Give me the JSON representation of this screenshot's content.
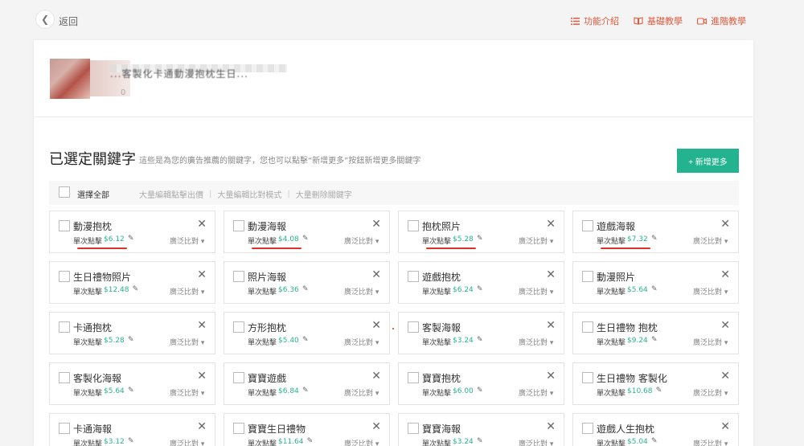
{
  "nav": {
    "back_label": "返回"
  },
  "toplinks": [
    {
      "label": "功能介紹",
      "icon": "list-icon"
    },
    {
      "label": "基礎教學",
      "icon": "book-icon"
    },
    {
      "label": "進階教學",
      "icon": "video-icon"
    }
  ],
  "product": {
    "title": "...客製化卡通動漫抱枕生日...",
    "sub": "0"
  },
  "section": {
    "title": "已選定關鍵字",
    "desc": "這些是為您的廣告推薦的關鍵字，您也可以點擊“新增更多”按鈕新增更多關鍵字",
    "add_label": "+ 新增更多"
  },
  "bulk": {
    "select_all": "選擇全部",
    "actions": [
      "大量編輯點擊出價",
      "大量編輯比對模式",
      "大量刪除關鍵字"
    ]
  },
  "labels": {
    "bid": "單次點擊",
    "match": "廣泛比對",
    "close": "✕",
    "pencil": "✎"
  },
  "keywords": [
    {
      "name": "動漫抱枕",
      "bid": "$6.12",
      "underlined": true
    },
    {
      "name": "動漫海報",
      "bid": "$4.08",
      "underlined": true
    },
    {
      "name": "抱枕照片",
      "bid": "$5.28",
      "underlined": true
    },
    {
      "name": "遊戲海報",
      "bid": "$7.32",
      "underlined": true
    },
    {
      "name": "生日禮物照片",
      "bid": "$12.48"
    },
    {
      "name": "照片海報",
      "bid": "$6.36"
    },
    {
      "name": "遊戲抱枕",
      "bid": "$6.24"
    },
    {
      "name": "動漫照片",
      "bid": "$5.64"
    },
    {
      "name": "卡通抱枕",
      "bid": "$5.28"
    },
    {
      "name": "方形抱枕",
      "bid": "$5.40"
    },
    {
      "name": "客製海報",
      "bid": "$3.24"
    },
    {
      "name": "生日禮物 抱枕",
      "bid": "$9.24"
    },
    {
      "name": "客製化海報",
      "bid": "$5.64"
    },
    {
      "name": "寶寶遊戲",
      "bid": "$6.84"
    },
    {
      "name": "寶寶抱枕",
      "bid": "$6.00"
    },
    {
      "name": "生日禮物 客製化",
      "bid": "$10.68"
    },
    {
      "name": "卡通海報",
      "bid": "$3.12"
    },
    {
      "name": "寶寶生日禮物",
      "bid": "$11.64"
    },
    {
      "name": "寶寶海報",
      "bid": "$3.24"
    },
    {
      "name": "遊戲人生抱枕",
      "bid": "$5.04"
    }
  ],
  "colors": {
    "accent": "#24b38f",
    "link": "#e25a3c",
    "annotation": "#d8322b"
  }
}
